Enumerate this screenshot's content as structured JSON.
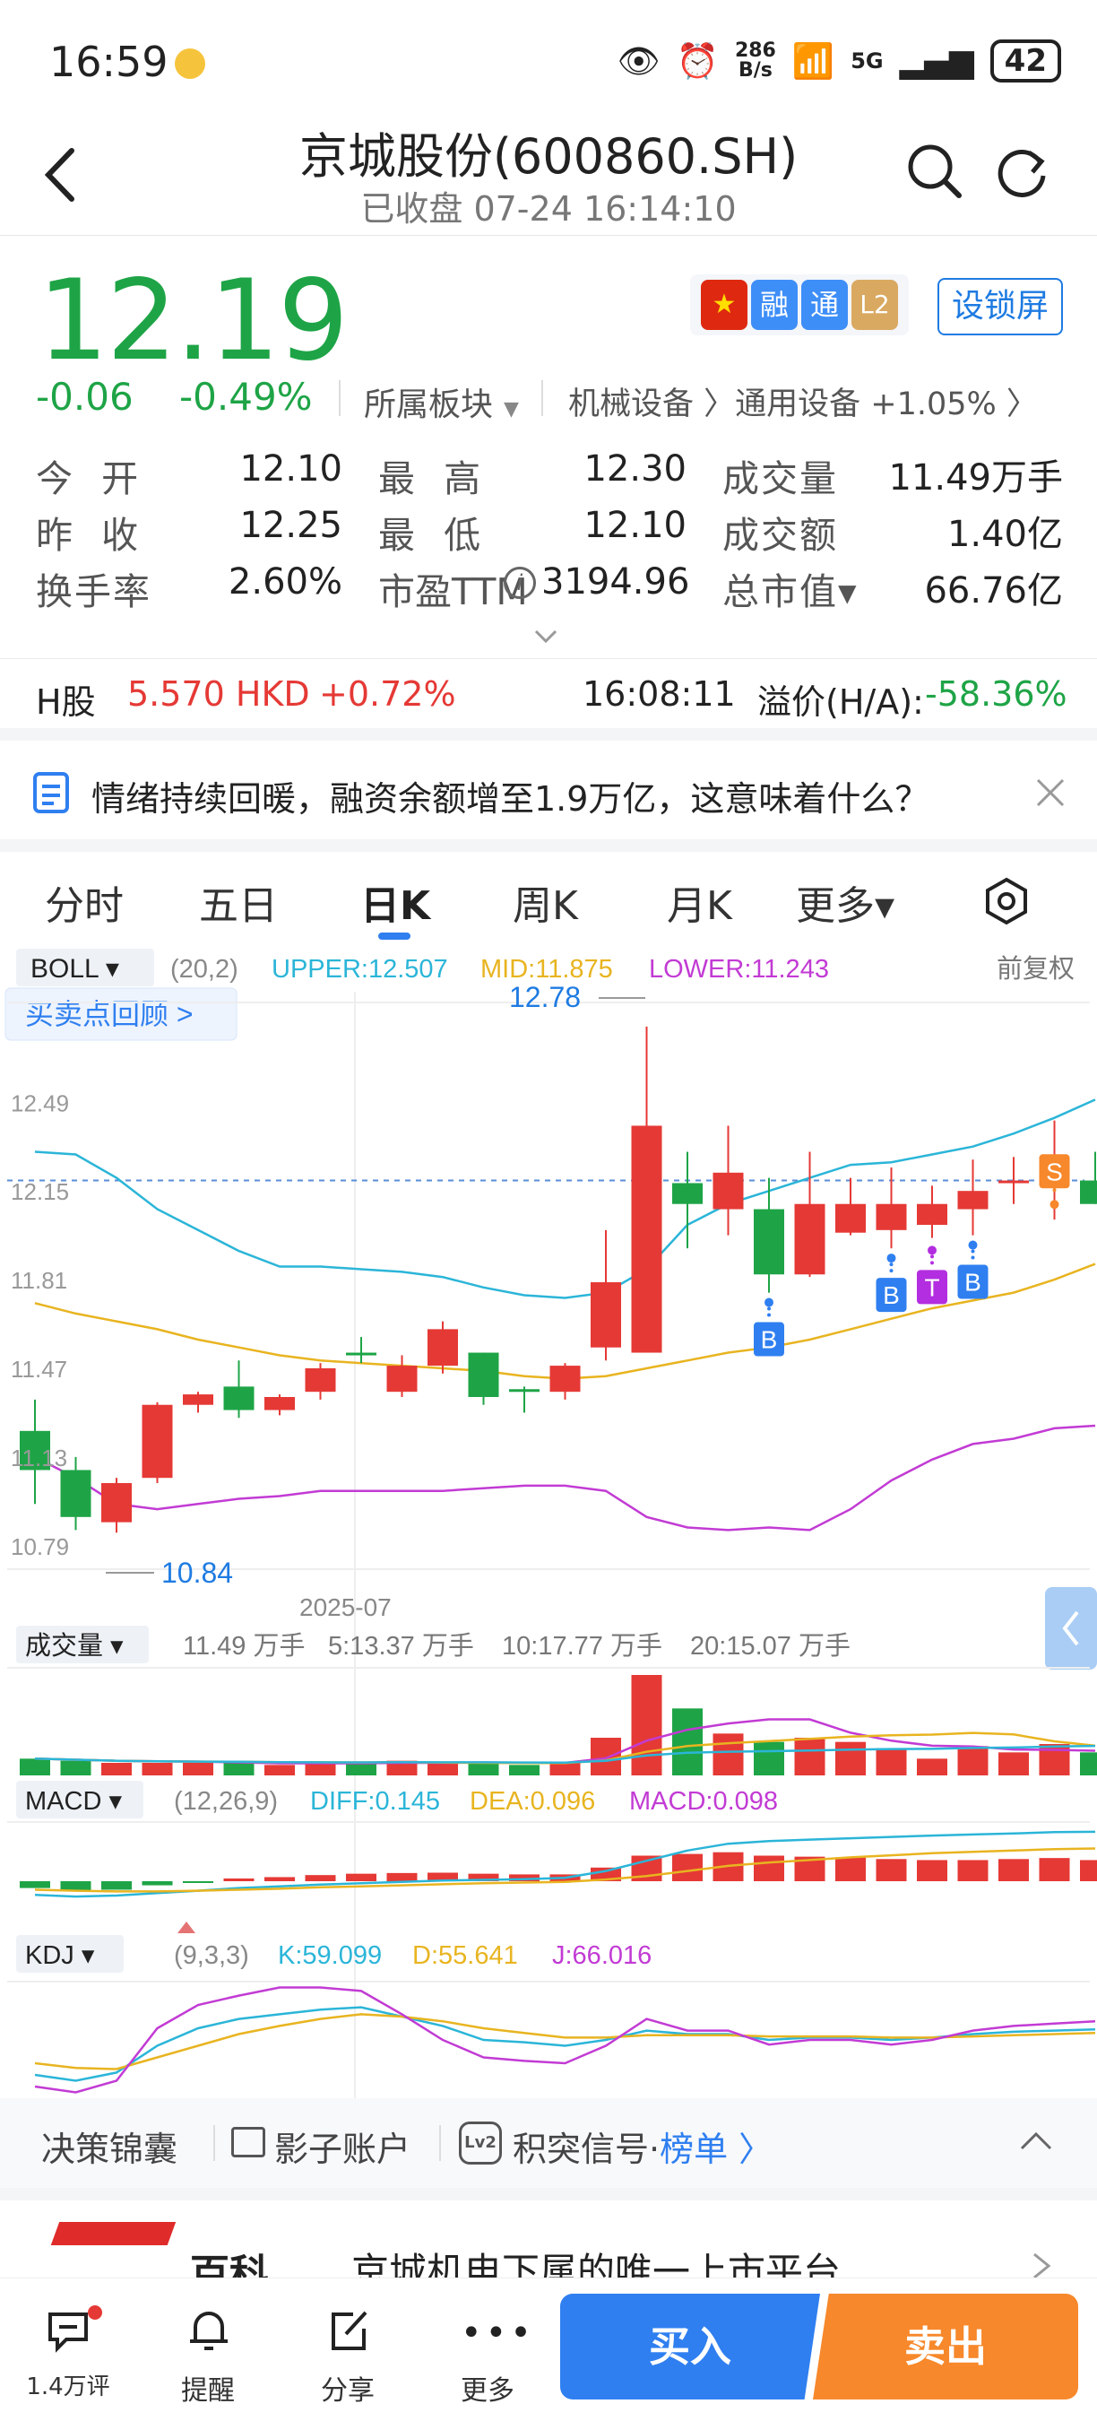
{
  "status_bar": {
    "time": "16:59",
    "net_speed_value": "286",
    "net_speed_unit": "B/s",
    "network": "5G",
    "battery": "42"
  },
  "header": {
    "title": "京城股份(600860.SH)",
    "subtitle": "已收盘 07-24 16:14:10"
  },
  "quote": {
    "price": "12.19",
    "change": "-0.06",
    "change_pct": "-0.49%",
    "sector_label": "所属板块",
    "sector_path": "机械设备 〉通用设备 +1.05% 〉",
    "badges": [
      "融",
      "通",
      "L2"
    ],
    "lock_button": "设锁屏"
  },
  "stats": [
    {
      "label": "今  开",
      "value": "12.10",
      "color": "green"
    },
    {
      "label": "最  高",
      "value": "12.30",
      "color": "red"
    },
    {
      "label": "成交量",
      "value": "11.49万手",
      "color": "plain"
    },
    {
      "label": "昨  收",
      "value": "12.25",
      "color": "plain"
    },
    {
      "label": "最  低",
      "value": "12.10",
      "color": "green"
    },
    {
      "label": "成交额",
      "value": "1.40亿",
      "color": "plain"
    },
    {
      "label": "换手率",
      "value": "2.60%",
      "color": "plain"
    },
    {
      "label": "市盈TTM",
      "value": "3194.96",
      "color": "plain"
    },
    {
      "label": "总市值▾",
      "value": "66.76亿",
      "color": "plain"
    }
  ],
  "h_share": {
    "label": "H股",
    "price": "5.570 HKD",
    "change": "+0.72%",
    "time": "16:08:11",
    "premium_label": "溢价(H/A):",
    "premium_value": "-58.36%"
  },
  "news": {
    "text": "情绪持续回暖，融资余额增至1.9万亿，这意味着什么？"
  },
  "tabs": [
    "分时",
    "五日",
    "日K",
    "周K",
    "月K",
    "更多▾"
  ],
  "active_tab": "日K",
  "chart": {
    "boll_label": "BOLL ▾",
    "boll_params": "(20,2)",
    "upper": "UPPER:12.507",
    "mid": "MID:11.875",
    "lower": "LOWER:11.243",
    "adjust": "前复权",
    "review_btn": "买卖点回顾 >",
    "high_marker": "12.78",
    "low_marker": "10.84",
    "date_label": "2025-07",
    "y_ticks": [
      "12.49",
      "12.15",
      "11.81",
      "11.47",
      "11.13",
      "10.79"
    ],
    "volume_label": "成交量 ▾",
    "volume_value": "11.49 万手",
    "vol_ma5": "5:13.37 万手",
    "vol_ma10": "10:17.77 万手",
    "vol_ma20": "20:15.07 万手",
    "macd_label": "MACD ▾",
    "macd_params": "(12,26,9)",
    "diff": "DIFF:0.145",
    "dea": "DEA:0.096",
    "macd": "MACD:0.098",
    "kdj_label": "KDJ ▾",
    "kdj_params": "(9,3,3)",
    "k": "K:59.099",
    "d": "D:55.641",
    "j": "J:66.016"
  },
  "colors": {
    "up": "#e53935",
    "down": "#1ea446",
    "upper_line": "#2bb5d8",
    "mid_line": "#e8b420",
    "lower_line": "#c23bd4",
    "accent": "#1e7be2"
  },
  "chart_data": {
    "type": "candlestick",
    "y_axis_ticks": [
      12.49,
      12.15,
      11.81,
      11.47,
      11.13,
      10.79
    ],
    "candles": [
      {
        "o": 11.23,
        "c": 11.08,
        "h": 11.35,
        "l": 10.95
      },
      {
        "o": 11.08,
        "c": 10.9,
        "h": 11.13,
        "l": 10.85
      },
      {
        "o": 10.88,
        "c": 11.03,
        "h": 11.05,
        "l": 10.84
      },
      {
        "o": 11.05,
        "c": 11.33,
        "h": 11.34,
        "l": 11.03
      },
      {
        "o": 11.33,
        "c": 11.37,
        "h": 11.38,
        "l": 11.3
      },
      {
        "o": 11.4,
        "c": 11.31,
        "h": 11.5,
        "l": 11.28
      },
      {
        "o": 11.31,
        "c": 11.36,
        "h": 11.37,
        "l": 11.29
      },
      {
        "o": 11.38,
        "c": 11.47,
        "h": 11.49,
        "l": 11.35
      },
      {
        "o": 11.53,
        "c": 11.52,
        "h": 11.59,
        "l": 11.49
      },
      {
        "o": 11.38,
        "c": 11.48,
        "h": 11.52,
        "l": 11.36
      },
      {
        "o": 11.48,
        "c": 11.62,
        "h": 11.65,
        "l": 11.45
      },
      {
        "o": 11.53,
        "c": 11.36,
        "h": 11.53,
        "l": 11.33
      },
      {
        "o": 11.39,
        "c": 11.38,
        "h": 11.4,
        "l": 11.3
      },
      {
        "o": 11.38,
        "c": 11.48,
        "h": 11.49,
        "l": 11.35
      },
      {
        "o": 11.55,
        "c": 11.8,
        "h": 12.0,
        "l": 11.5
      },
      {
        "o": 11.53,
        "c": 12.4,
        "h": 12.78,
        "l": 11.53
      },
      {
        "o": 12.18,
        "c": 12.1,
        "h": 12.3,
        "l": 11.93
      },
      {
        "o": 12.08,
        "c": 12.22,
        "h": 12.4,
        "l": 11.98
      },
      {
        "o": 12.08,
        "c": 11.83,
        "h": 12.2,
        "l": 11.76
      },
      {
        "o": 11.83,
        "c": 12.1,
        "h": 12.3,
        "l": 11.82
      },
      {
        "o": 11.99,
        "c": 12.1,
        "h": 12.2,
        "l": 11.98
      },
      {
        "o": 12.0,
        "c": 12.1,
        "h": 12.24,
        "l": 11.93
      },
      {
        "o": 12.02,
        "c": 12.1,
        "h": 12.17,
        "l": 11.97
      },
      {
        "o": 12.08,
        "c": 12.15,
        "h": 12.27,
        "l": 11.98
      },
      {
        "o": 12.19,
        "c": 12.19,
        "h": 12.28,
        "l": 12.1
      },
      {
        "o": 12.22,
        "c": 12.22,
        "h": 12.42,
        "l": 12.04
      },
      {
        "o": 12.19,
        "c": 12.1,
        "h": 12.3,
        "l": 12.1
      }
    ],
    "boll_upper": [
      12.3,
      12.29,
      12.2,
      12.08,
      12.0,
      11.92,
      11.86,
      11.86,
      11.85,
      11.84,
      11.82,
      11.78,
      11.75,
      11.74,
      11.76,
      11.85,
      12.02,
      12.1,
      12.15,
      12.2,
      12.25,
      12.26,
      12.29,
      12.32,
      12.37,
      12.43,
      12.5
    ],
    "boll_mid": [
      11.72,
      11.68,
      11.65,
      11.62,
      11.58,
      11.55,
      11.52,
      11.5,
      11.49,
      11.48,
      11.47,
      11.46,
      11.44,
      11.43,
      11.44,
      11.47,
      11.5,
      11.53,
      11.55,
      11.58,
      11.62,
      11.66,
      11.7,
      11.73,
      11.76,
      11.81,
      11.87
    ],
    "boll_lower": [
      11.13,
      11.05,
      10.95,
      10.93,
      10.95,
      10.97,
      10.98,
      11.0,
      11.0,
      11.0,
      11.0,
      11.01,
      11.02,
      11.02,
      11.0,
      10.9,
      10.86,
      10.85,
      10.86,
      10.85,
      10.93,
      11.04,
      11.12,
      11.18,
      11.2,
      11.24,
      11.25
    ],
    "volume": [
      8,
      7,
      6,
      6,
      6,
      6,
      5,
      6,
      6,
      7,
      6,
      6,
      5,
      6,
      18,
      48,
      32,
      20,
      16,
      18,
      16,
      13,
      8,
      14,
      11,
      15,
      11
    ],
    "macd_hist": [
      -0.02,
      -0.028,
      -0.025,
      -0.012,
      -0.002,
      0.008,
      0.012,
      0.018,
      0.022,
      0.024,
      0.025,
      0.022,
      0.02,
      0.02,
      0.04,
      0.075,
      0.08,
      0.085,
      0.075,
      0.072,
      0.07,
      0.065,
      0.062,
      0.062,
      0.065,
      0.068,
      0.062
    ],
    "macd_diff": [
      -0.04,
      -0.045,
      -0.042,
      -0.035,
      -0.028,
      -0.02,
      -0.015,
      -0.01,
      -0.006,
      -0.002,
      0.002,
      0.004,
      0.006,
      0.01,
      0.03,
      0.06,
      0.09,
      0.11,
      0.118,
      0.122,
      0.126,
      0.13,
      0.134,
      0.137,
      0.14,
      0.144,
      0.145
    ],
    "macd_dea": [
      -0.025,
      -0.028,
      -0.03,
      -0.03,
      -0.028,
      -0.025,
      -0.022,
      -0.018,
      -0.015,
      -0.012,
      -0.009,
      -0.006,
      -0.004,
      -0.002,
      0.005,
      0.015,
      0.03,
      0.045,
      0.055,
      0.062,
      0.07,
      0.076,
      0.082,
      0.086,
      0.09,
      0.094,
      0.096
    ],
    "kdj_k": [
      20,
      15,
      22,
      45,
      60,
      68,
      72,
      76,
      78,
      70,
      62,
      50,
      48,
      45,
      50,
      58,
      55,
      55,
      50,
      52,
      52,
      50,
      52,
      55,
      57,
      58,
      59
    ],
    "kdj_d": [
      30,
      26,
      25,
      35,
      45,
      55,
      62,
      68,
      72,
      70,
      66,
      60,
      56,
      52,
      52,
      54,
      54,
      54,
      53,
      53,
      53,
      52,
      52,
      53,
      54,
      55,
      56
    ],
    "kdj_j": [
      10,
      5,
      15,
      60,
      80,
      88,
      95,
      95,
      92,
      72,
      50,
      35,
      32,
      30,
      45,
      68,
      58,
      58,
      46,
      50,
      50,
      46,
      50,
      58,
      62,
      64,
      66
    ]
  },
  "footer_tools": [
    "决策锦囊",
    "影子账户",
    "积突信号·",
    "榜单 〉"
  ],
  "company_card": {
    "name": "百科",
    "desc": "京城机电下属的唯一上市平台"
  },
  "bottom_nav": {
    "comments": "1.4万评",
    "remind": "提醒",
    "share": "分享",
    "more": "更多",
    "buy": "买入",
    "sell": "卖出"
  }
}
